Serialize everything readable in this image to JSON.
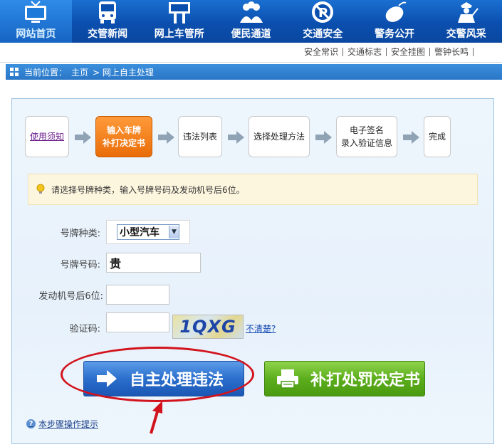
{
  "nav": {
    "items": [
      {
        "label": "网站首页",
        "icon": "tv-icon"
      },
      {
        "label": "交管新闻",
        "icon": "bus-icon"
      },
      {
        "label": "网上车管所",
        "icon": "signboard-icon"
      },
      {
        "label": "便民通道",
        "icon": "people-icon"
      },
      {
        "label": "交通安全",
        "icon": "no-parking-icon"
      },
      {
        "label": "警务公开",
        "icon": "mouse-icon"
      },
      {
        "label": "交警风采",
        "icon": "police-icon"
      }
    ],
    "active_index": 0
  },
  "subnav": {
    "links": [
      "安全常识",
      "交通标志",
      "安全挂图",
      "警钟长鸣"
    ]
  },
  "breadcrumb": {
    "label": "当前位置：",
    "home": "主页",
    "current": "> 网上自主处理"
  },
  "steps": {
    "items": [
      "使用须知",
      "输入车牌\n补打决定书",
      "违法列表",
      "选择处理方法",
      "电子签名\n录入验证信息",
      "完成"
    ],
    "current_index": 1
  },
  "hint": {
    "text": "请选择号牌种类，输入号牌号码及发动机号后6位。"
  },
  "form": {
    "plate_type_label": "号牌种类:",
    "plate_type_value": "小型汽车",
    "plate_number_label": "号牌号码:",
    "plate_number_value": "贵",
    "engine_label": "发动机号后6位:",
    "engine_value": "",
    "captcha_label": "验证码:",
    "captcha_value": "",
    "captcha_image_text": "1QXG",
    "unclear_link": "不清楚?"
  },
  "buttons": {
    "self_process": "自主处理违法",
    "reprint": "补打处罚决定书"
  },
  "help": {
    "text": "本步骤操作提示"
  },
  "colors": {
    "nav_bg": "#0b4fae",
    "step_current": "#e96d09",
    "btn_blue": "#2b6fcd",
    "btn_green": "#5cae1d",
    "annotation_red": "#d2131d"
  }
}
